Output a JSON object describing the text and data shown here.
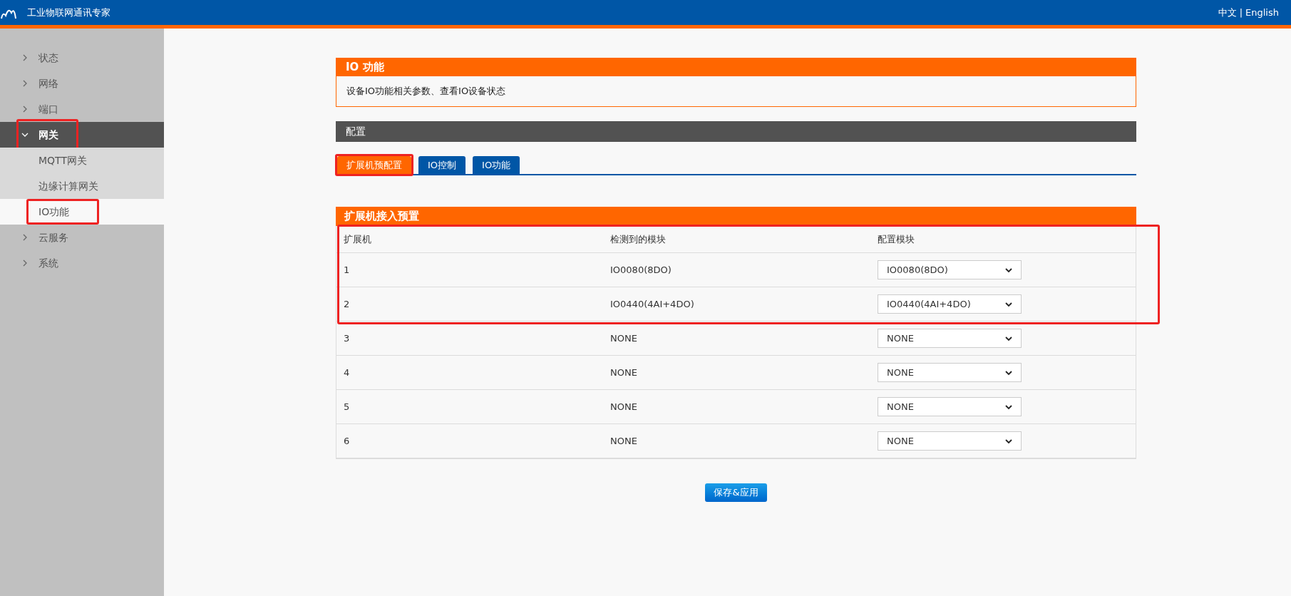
{
  "header": {
    "brand": "工业物联网通讯专家",
    "languages": [
      "中文",
      "English"
    ],
    "separator": "|"
  },
  "sidebar": {
    "items": [
      {
        "label": "状态",
        "expanded": false,
        "selected": false,
        "annotated": false
      },
      {
        "label": "网络",
        "expanded": false,
        "selected": false,
        "annotated": false
      },
      {
        "label": "端口",
        "expanded": false,
        "selected": false,
        "annotated": false
      },
      {
        "label": "网关",
        "expanded": true,
        "selected": true,
        "annotated": true,
        "children": [
          {
            "label": "MQTT网关",
            "selected": false,
            "annotated": false
          },
          {
            "label": "边缘计算网关",
            "selected": false,
            "annotated": false
          },
          {
            "label": "IO功能",
            "selected": true,
            "annotated": true
          }
        ]
      },
      {
        "label": "云服务",
        "expanded": false,
        "selected": false,
        "annotated": false
      },
      {
        "label": "系统",
        "expanded": false,
        "selected": false,
        "annotated": false
      }
    ]
  },
  "page": {
    "title": "IO 功能",
    "description": "设备IO功能相关参数、查看IO设备状态"
  },
  "config": {
    "title": "配置",
    "tabs": [
      {
        "label": "扩展机预配置",
        "selected": true,
        "annotated": true
      },
      {
        "label": "IO控制",
        "selected": false,
        "annotated": false
      },
      {
        "label": "IO功能",
        "selected": false,
        "annotated": false
      }
    ]
  },
  "table": {
    "title": "扩展机接入预置",
    "columns": [
      "扩展机",
      "检测到的模块",
      "配置模块"
    ],
    "header_annotated": true,
    "rows": [
      {
        "unit": "1",
        "detected": "IO0080(8DO)",
        "configured": "IO0080(8DO)",
        "annotated": true
      },
      {
        "unit": "2",
        "detected": "IO0440(4AI+4DO)",
        "configured": "IO0440(4AI+4DO)",
        "annotated": true
      },
      {
        "unit": "3",
        "detected": "NONE",
        "configured": "NONE",
        "annotated": false
      },
      {
        "unit": "4",
        "detected": "NONE",
        "configured": "NONE",
        "annotated": false
      },
      {
        "unit": "5",
        "detected": "NONE",
        "configured": "NONE",
        "annotated": false
      },
      {
        "unit": "6",
        "detected": "NONE",
        "configured": "NONE",
        "annotated": false
      }
    ]
  },
  "save_button": "保存&应用"
}
